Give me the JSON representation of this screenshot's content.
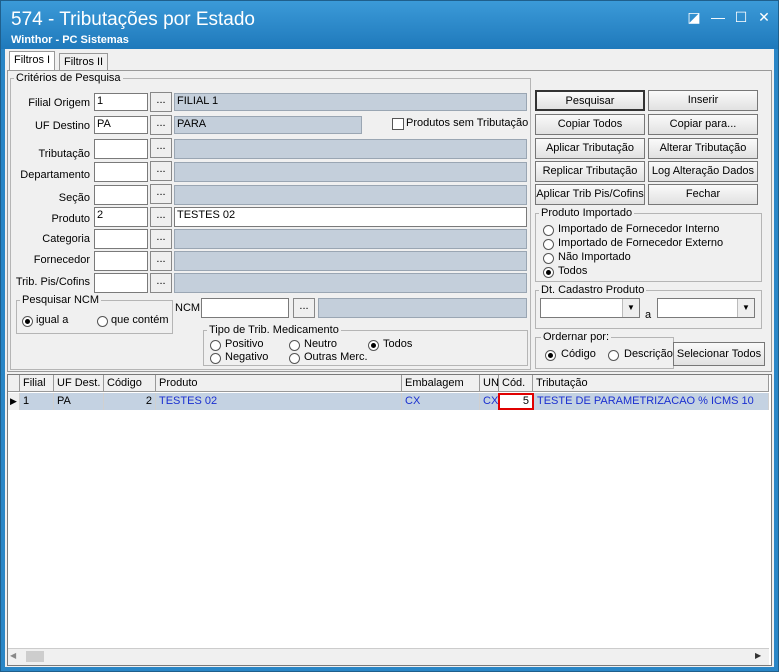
{
  "window": {
    "title": "574 - Tributações por Estado",
    "subtitle": "Winthor - PC Sistemas",
    "controls": [
      "◪",
      "—",
      "☐",
      "✕"
    ]
  },
  "tabs": [
    "Filtros I",
    "Filtros II"
  ],
  "criteria": {
    "group_title": "Critérios de Pesquisa",
    "filial_label": "Filial Origem",
    "filial_value": "1",
    "filial_desc": "FILIAL 1",
    "uf_label": "UF Destino",
    "uf_value": "PA",
    "uf_desc": "PARA",
    "sem_trib_label": "Produtos sem Tributação",
    "tributacao_label": "Tributação",
    "departamento_label": "Departamento",
    "secao_label": "Seção",
    "produto_label": "Produto",
    "produto_value": "2",
    "produto_desc": "TESTES 02",
    "categoria_label": "Categoria",
    "fornecedor_label": "Fornecedor",
    "trib_pis_label": "Trib. Pis/Cofins",
    "dots": "...",
    "ncm_group": "Pesquisar NCM",
    "ncm_igual": "igual a",
    "ncm_contem": "que contém",
    "ncm_label": "NCM",
    "med_group": "Tipo de Trib. Medicamento",
    "med_positivo": "Positivo",
    "med_negativo": "Negativo",
    "med_neutro": "Neutro",
    "med_outras": "Outras Merc.",
    "med_todos": "Todos"
  },
  "buttons": {
    "pesquisar": "Pesquisar",
    "inserir": "Inserir",
    "copiar_todos": "Copiar Todos",
    "copiar_para": "Copiar para...",
    "aplicar_trib": "Aplicar Tributação",
    "alterar_trib": "Alterar Tributação",
    "replicar_trib": "Replicar Tributação",
    "log_alteracao": "Log Alteração Dados",
    "aplicar_pis": "Aplicar Trib Pis/Cofins",
    "fechar": "Fechar",
    "selecionar_todos": "Selecionar Todos"
  },
  "produto_importado": {
    "title": "Produto Importado",
    "opt1": "Importado de Fornecedor Interno",
    "opt2": "Importado de Fornecedor Externo",
    "opt3": "Não Importado",
    "opt4": "Todos"
  },
  "dt_cadastro": {
    "title": "Dt. Cadastro Produto",
    "sep": "a"
  },
  "ordenar": {
    "title": "Ordernar por:",
    "codigo": "Código",
    "descricao": "Descrição"
  },
  "grid": {
    "headers": [
      "Filial",
      "UF Dest.",
      "Código",
      "Produto",
      "Embalagem",
      "UN",
      "Cód.",
      "Tributação"
    ],
    "rows": [
      {
        "filial": "1",
        "uf": "PA",
        "codigo": "2",
        "produto": "TESTES 02",
        "embalagem": "CX",
        "un": "CX",
        "cod": "5",
        "tributacao": "TESTE DE PARAMETRIZACAO % ICMS 10"
      }
    ]
  },
  "colors": {
    "title_bar": "#2a86c6",
    "readonly_field": "#c4cfdb",
    "selected_row": "#c4d2e2",
    "highlight_text": "#1a2fd0",
    "highlight_box": "#e00000"
  }
}
